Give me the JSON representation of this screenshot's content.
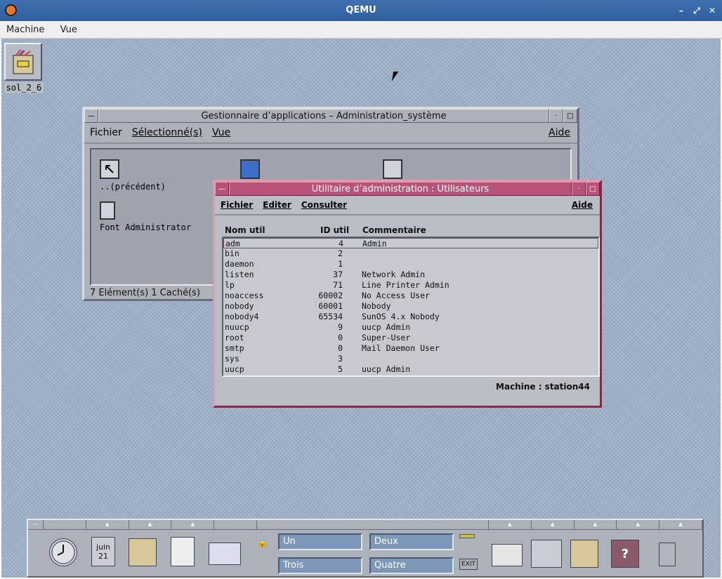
{
  "window": {
    "title": "QEMU",
    "min": "–",
    "restore": "⤢",
    "close": "✕"
  },
  "menubar": [
    "Machine",
    "Vue"
  ],
  "desktop_icon": {
    "label": "sol_2_6"
  },
  "app_manager": {
    "title": "Gestionnaire d’applications – Administration_système",
    "menu": {
      "file": "Fichier",
      "selected": "Sélectionné(s)",
      "view": "Vue",
      "help": "Aide"
    },
    "items": [
      {
        "label": "..(précédent)"
      },
      {
        "label": "Font Administrator"
      }
    ],
    "status": "7 Elément(s) 1 Caché(s)"
  },
  "users": {
    "title": "Utilitaire d’administration : Utilisateurs",
    "menu": {
      "file": "Fichier",
      "edit": "Editer",
      "view": "Consulter",
      "help": "Aide"
    },
    "headers": [
      "Nom util",
      "ID util",
      "Commentaire"
    ],
    "rows": [
      [
        "adm",
        "4",
        "Admin"
      ],
      [
        "bin",
        "2",
        ""
      ],
      [
        "daemon",
        "1",
        ""
      ],
      [
        "listen",
        "37",
        "Network Admin"
      ],
      [
        "lp",
        "71",
        "Line Printer Admin"
      ],
      [
        "noaccess",
        "60002",
        "No Access User"
      ],
      [
        "nobody",
        "60001",
        "Nobody"
      ],
      [
        "nobody4",
        "65534",
        "SunOS 4.x Nobody"
      ],
      [
        "nuucp",
        "9",
        "uucp Admin"
      ],
      [
        "root",
        "0",
        "Super-User"
      ],
      [
        "smtp",
        "0",
        "Mail Daemon User"
      ],
      [
        "sys",
        "3",
        ""
      ],
      [
        "uucp",
        "5",
        "uucp Admin"
      ]
    ],
    "footer": "Machine : station44"
  },
  "panel": {
    "calendar_month": "juin",
    "calendar_day": "21",
    "workspaces": [
      "Un",
      "Deux",
      "Trois",
      "Quatre"
    ],
    "exit": "EXIT",
    "help": "?"
  }
}
